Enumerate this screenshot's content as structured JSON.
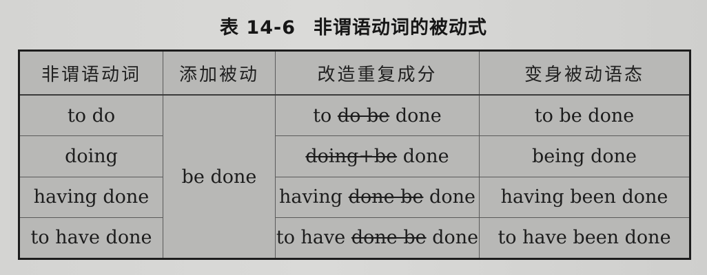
{
  "title": {
    "number": "表 14-6",
    "text": "非谓语动词的被动式"
  },
  "table": {
    "headers": [
      "非谓语动词",
      "添加被动",
      "改造重复成分",
      "变身被动语态"
    ],
    "merged_add_passive": "be done",
    "rows": [
      {
        "nonfinite": "to do",
        "transform": {
          "before": "to ",
          "struck": "do be",
          "after": " done"
        },
        "result": "to be done"
      },
      {
        "nonfinite": "doing",
        "transform": {
          "before": "",
          "struck": "doing+be",
          "after": " done"
        },
        "result": "being done"
      },
      {
        "nonfinite": "having done",
        "transform": {
          "before": "having ",
          "struck": "done be",
          "after": " done"
        },
        "result": "having been done"
      },
      {
        "nonfinite": "to have done",
        "transform": {
          "before": "to have ",
          "struck": "done be",
          "after": " done"
        },
        "result": "to have been done"
      }
    ]
  }
}
